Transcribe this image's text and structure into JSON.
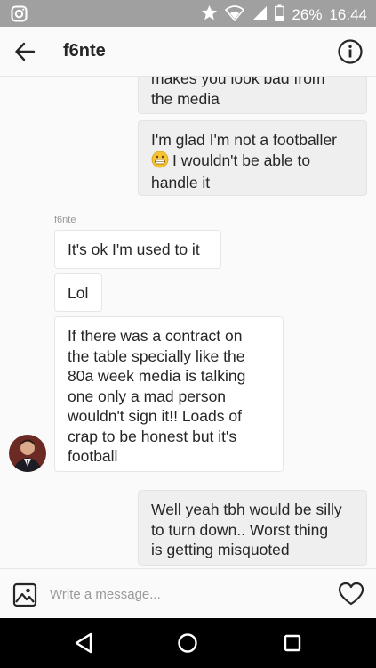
{
  "status_bar": {
    "battery": "26%",
    "time": "16:44",
    "icons": [
      "instagram-icon",
      "star-icon",
      "wifi-icon",
      "signal-icon",
      "battery-icon"
    ]
  },
  "header": {
    "title": "f6nte",
    "icons": [
      "back-arrow-icon",
      "info-icon"
    ]
  },
  "messages": [
    {
      "direction": "out",
      "lines": [
        "makes you look bad from",
        "the media"
      ]
    },
    {
      "direction": "out",
      "lines": [
        "I'm glad I'm not a footballer",
        "I wouldn't be able to",
        "handle it"
      ],
      "emoji": "grinning-face-icon"
    },
    {
      "direction": "in",
      "sender": "f6nte",
      "lines": [
        "It's ok I'm used to it"
      ]
    },
    {
      "direction": "in",
      "lines": [
        "Lol"
      ]
    },
    {
      "direction": "in",
      "lines": [
        "If there was a contract on",
        "the table specially like the",
        "80a week media is talking",
        "one only a mad person",
        "wouldn't sign it!! Loads of",
        "crap to be honest but it's",
        "football"
      ]
    },
    {
      "direction": "out",
      "lines": [
        "Well yeah tbh would be silly",
        "to turn down.. Worst thing",
        "is getting misquoted"
      ]
    }
  ],
  "composer": {
    "placeholder": "Write a message...",
    "icons": [
      "gallery-icon",
      "heart-icon"
    ]
  },
  "nav": {
    "icons": [
      "back-triangle-icon",
      "home-circle-icon",
      "recents-square-icon"
    ]
  },
  "colors": {
    "status_bar_bg": "#a0a0a0",
    "outgoing_bubble": "#efefef",
    "incoming_bubble": "#ffffff",
    "nav_bar_bg": "#000000"
  }
}
